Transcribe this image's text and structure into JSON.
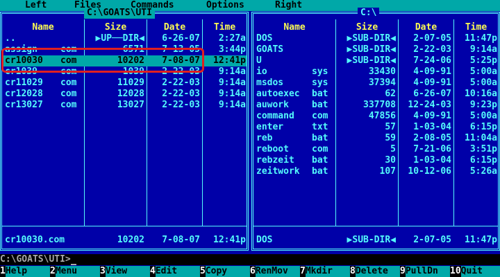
{
  "menu": [
    "Left",
    "Files",
    "Commands",
    "Options",
    "Right"
  ],
  "left_panel": {
    "title": "C:\\GOATS\\UTI",
    "columns": [
      "Name",
      "Size",
      "Date",
      "Time"
    ],
    "rows": [
      {
        "name": "..",
        "ext": "",
        "size": "▶UP──DIR◀",
        "date": "6-26-07",
        "time": "2:27a"
      },
      {
        "name": "assign",
        "ext": "com",
        "size": "6571",
        "date": "7-13-05",
        "time": "3:44p"
      },
      {
        "name": "cr10030",
        "ext": "com",
        "size": "10202",
        "date": "7-08-07",
        "time": "12:41p"
      },
      {
        "name": "cr1039",
        "ext": "com",
        "size": "1039",
        "date": "2-22-03",
        "time": "9:14a"
      },
      {
        "name": "cr11029",
        "ext": "com",
        "size": "11029",
        "date": "2-22-03",
        "time": "9:14a"
      },
      {
        "name": "cr12028",
        "ext": "com",
        "size": "12028",
        "date": "2-22-03",
        "time": "9:14a"
      },
      {
        "name": "cr13027",
        "ext": "com",
        "size": "13027",
        "date": "2-22-03",
        "time": "9:14a"
      }
    ],
    "info": {
      "name": "cr10030.com",
      "size": "10202",
      "date": "7-08-07",
      "time": "12:41p"
    }
  },
  "right_panel": {
    "title": "C:\\",
    "columns": [
      "Name",
      "Size",
      "Date",
      "Time"
    ],
    "rows": [
      {
        "name": "DOS",
        "ext": "",
        "size": "▶SUB-DIR◀",
        "date": "2-07-05",
        "time": "11:47p"
      },
      {
        "name": "GOATS",
        "ext": "",
        "size": "▶SUB-DIR◀",
        "date": "2-22-03",
        "time": "9:14a"
      },
      {
        "name": "U",
        "ext": "",
        "size": "▶SUB-DIR◀",
        "date": "7-24-06",
        "time": "5:25p"
      },
      {
        "name": "io",
        "ext": "sys",
        "size": "33430",
        "date": "4-09-91",
        "time": "5:00a"
      },
      {
        "name": "msdos",
        "ext": "sys",
        "size": "37394",
        "date": "4-09-91",
        "time": "5:00a"
      },
      {
        "name": "autoexec",
        "ext": "bat",
        "size": "62",
        "date": "6-26-07",
        "time": "10:16a"
      },
      {
        "name": "auwork",
        "ext": "bat",
        "size": "337708",
        "date": "12-24-03",
        "time": "9:23p"
      },
      {
        "name": "command",
        "ext": "com",
        "size": "47856",
        "date": "4-09-91",
        "time": "5:00a"
      },
      {
        "name": "enter",
        "ext": "txt",
        "size": "57",
        "date": "1-03-04",
        "time": "6:15p"
      },
      {
        "name": "reb",
        "ext": "bat",
        "size": "59",
        "date": "2-08-05",
        "time": "11:04a"
      },
      {
        "name": "reboot",
        "ext": "com",
        "size": "5",
        "date": "7-21-06",
        "time": "3:51p"
      },
      {
        "name": "rebzeit",
        "ext": "bat",
        "size": "30",
        "date": "1-03-04",
        "time": "6:15p"
      },
      {
        "name": "zeitwork",
        "ext": "bat",
        "size": "107",
        "date": "10-12-06",
        "time": "5:26a"
      }
    ],
    "info": {
      "name": "DOS",
      "size": "▶SUB-DIR◀",
      "date": "2-07-05",
      "time": "11:47p"
    }
  },
  "command_line": "C:\\GOATS\\UTI>",
  "keybar": [
    {
      "num": "1",
      "label": "Help"
    },
    {
      "num": "2",
      "label": "Menu"
    },
    {
      "num": "3",
      "label": "View"
    },
    {
      "num": "4",
      "label": "Edit"
    },
    {
      "num": "5",
      "label": "Copy"
    },
    {
      "num": "6",
      "label": "RenMov"
    },
    {
      "num": "7",
      "label": "Mkdir"
    },
    {
      "num": "8",
      "label": "Delete"
    },
    {
      "num": "9",
      "label": "PullDn"
    },
    {
      "num": "10",
      "label": "Quit"
    }
  ],
  "colors": {
    "background": "#0000a8",
    "accent": "#00a8a8",
    "text": "#54fcfc",
    "header": "#fcfc54",
    "annotation": "#e02020"
  }
}
